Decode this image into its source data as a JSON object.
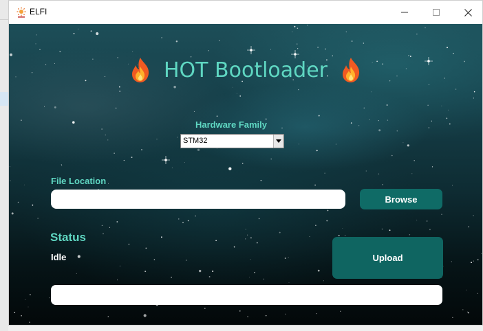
{
  "window": {
    "title": "ELFI",
    "app_icon": "sun-icon",
    "controls": [
      "minimize-icon",
      "maximize-icon",
      "close-icon"
    ]
  },
  "header": {
    "title": "HOT Bootloader",
    "icons": [
      "flame-icon",
      "flame-icon"
    ]
  },
  "hardware": {
    "label": "Hardware Family",
    "selected": "STM32"
  },
  "file": {
    "label": "File Location",
    "value": "",
    "browse_label": "Browse"
  },
  "status": {
    "label": "Status",
    "value": "Idle"
  },
  "upload": {
    "label": "Upload"
  },
  "progress": {
    "percent": 0
  },
  "colors": {
    "accent": "#5fd7c2",
    "button": "#0f6b66"
  }
}
